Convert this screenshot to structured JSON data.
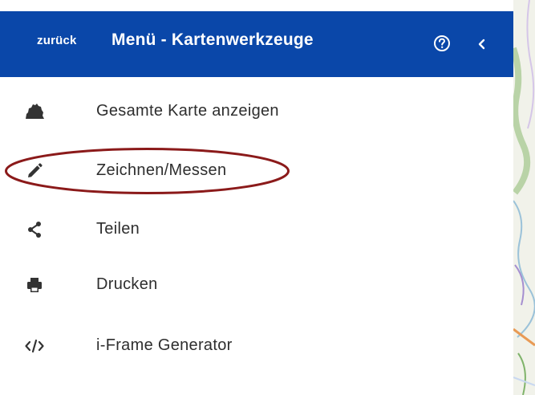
{
  "header": {
    "back_label": "zurück",
    "title": "Menü - Kartenwerkzeuge",
    "background_color": "#0a47a9"
  },
  "menu": {
    "items": [
      {
        "label": "Gesamte Karte anzeigen",
        "icon": "region-map-icon"
      },
      {
        "label": "Zeichnen/Messen",
        "icon": "pencil-icon",
        "highlighted": true
      },
      {
        "label": "Teilen",
        "icon": "share-icon"
      },
      {
        "label": "Drucken",
        "icon": "printer-icon"
      },
      {
        "label": "i-Frame Generator",
        "icon": "code-icon"
      }
    ]
  },
  "annotation": {
    "ellipse_color": "#8b1a1a"
  }
}
